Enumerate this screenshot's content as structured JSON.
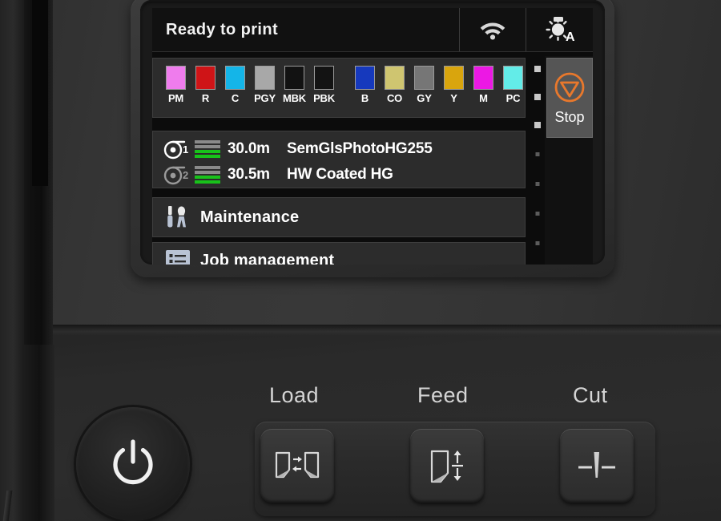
{
  "device": {
    "type": "large-format-printer-control-panel",
    "accent_orange": "#e8782c"
  },
  "screen": {
    "status_bar": {
      "message": "Ready to print",
      "icons": [
        {
          "name": "wifi-icon",
          "label": "Wi-Fi"
        },
        {
          "name": "lamp-auto-icon",
          "label": "A"
        }
      ]
    },
    "ink": {
      "groups": [
        {
          "cartridges": [
            {
              "code": "PM",
              "color": "#ef7ced"
            },
            {
              "code": "R",
              "color": "#cf1417"
            },
            {
              "code": "C",
              "color": "#14b5e8"
            },
            {
              "code": "PGY",
              "color": "#a8a8a8"
            },
            {
              "code": "MBK",
              "color": "#121212"
            },
            {
              "code": "PBK",
              "color": "#131313"
            }
          ]
        },
        {
          "cartridges": [
            {
              "code": "B",
              "color": "#1639bd"
            },
            {
              "code": "CO",
              "color": "#cfc570"
            },
            {
              "code": "GY",
              "color": "#767676"
            },
            {
              "code": "Y",
              "color": "#d9a50d"
            },
            {
              "code": "M",
              "color": "#ec18e4"
            },
            {
              "code": "PC",
              "color": "#63ece8"
            }
          ]
        }
      ]
    },
    "rolls": [
      {
        "number": "1",
        "length": "30.0m",
        "media": "SemGlsPhotoHG255",
        "level_bars": [
          "empty",
          "empty",
          "full",
          "full"
        ],
        "active": true
      },
      {
        "number": "2",
        "length": "30.5m",
        "media": "HW Coated HG",
        "level_bars": [
          "empty",
          "empty",
          "full",
          "full"
        ],
        "active": false
      }
    ],
    "menu_rows": [
      {
        "icon": "tools-icon",
        "label": "Maintenance"
      },
      {
        "icon": "list-icon",
        "label": "Job management"
      }
    ],
    "scroll_dots": {
      "total": 8,
      "active": 3
    },
    "stop_button": {
      "label": "Stop",
      "icon": "stop-triangle-icon",
      "color": "#e8782c"
    }
  },
  "hardware": {
    "power_button": {
      "name": "power-button",
      "icon": "power-icon"
    },
    "buttons": [
      {
        "label": "Load",
        "icon": "load-paper-icon"
      },
      {
        "label": "Feed",
        "icon": "feed-paper-icon"
      },
      {
        "label": "Cut",
        "icon": "cutter-blade-icon"
      }
    ]
  }
}
